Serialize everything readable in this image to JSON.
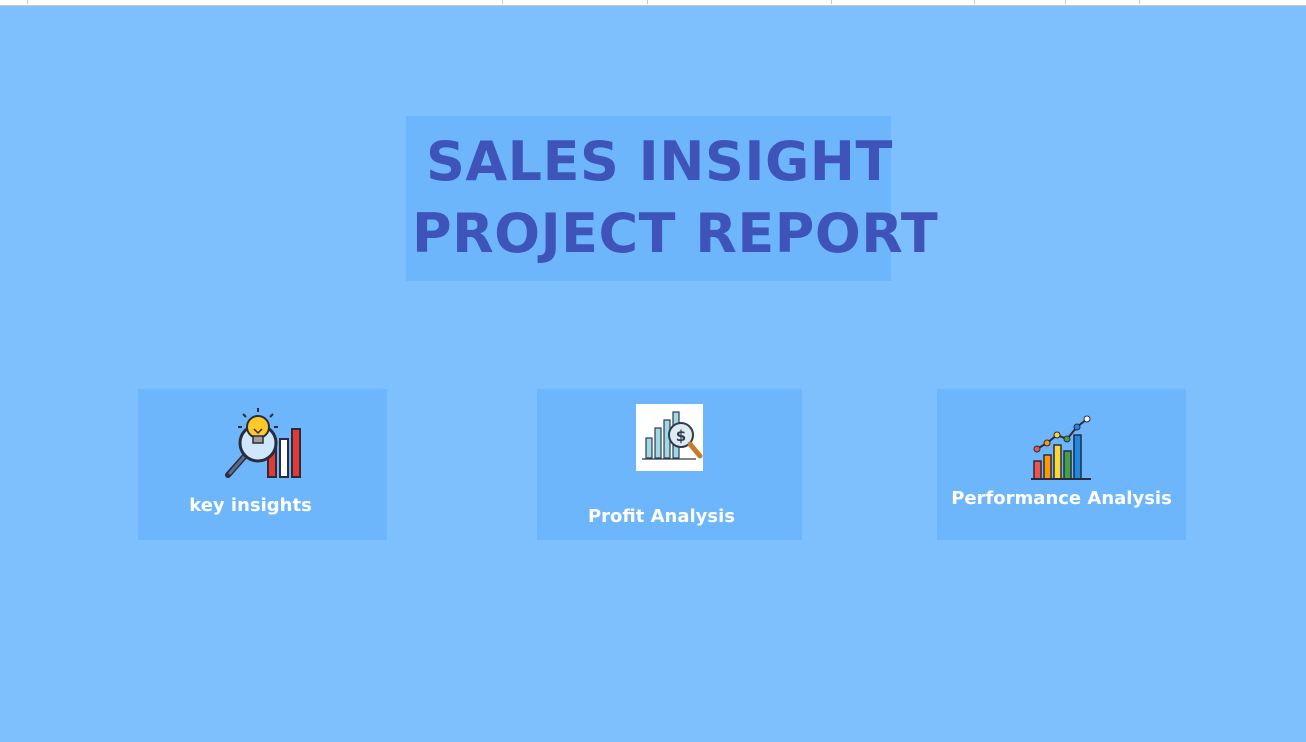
{
  "title": {
    "line1": "SALES INSIGHT",
    "line2": "PROJECT REPORT"
  },
  "cards": [
    {
      "label": "key insights",
      "icon": "lightbulb-magnifier-chart-icon"
    },
    {
      "label": "Profit Analysis",
      "icon": "dollar-magnifier-chart-icon"
    },
    {
      "label": "Performance Analysis",
      "icon": "growth-bar-line-chart-icon"
    }
  ],
  "colors": {
    "background": "#7dc0fd",
    "panel": "#6eb6fc",
    "title_text": "#3f54b8",
    "card_text": "#ffffff"
  }
}
